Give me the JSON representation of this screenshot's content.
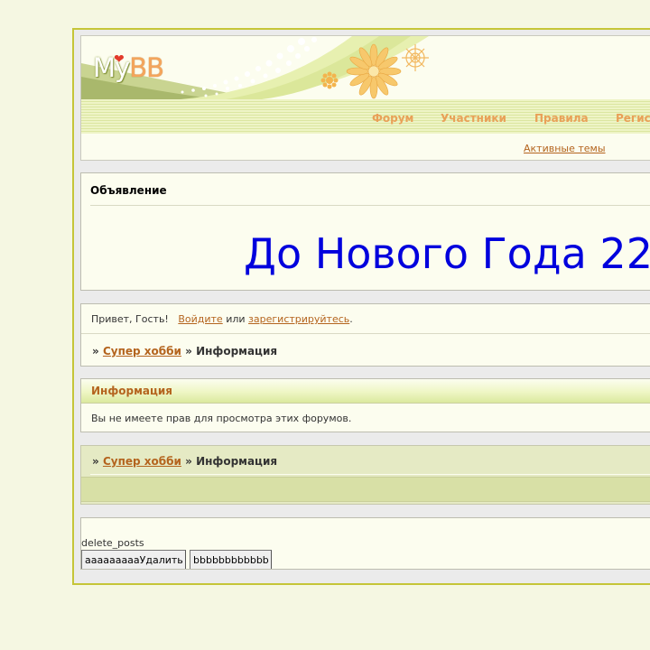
{
  "header": {
    "logo_my": "My",
    "logo_bb": "BB",
    "nav": [
      {
        "label": "Форум"
      },
      {
        "label": "Участники"
      },
      {
        "label": "Правила"
      },
      {
        "label": "Регис"
      }
    ],
    "active_topics": "Активные темы"
  },
  "announcement": {
    "title": "Объявление",
    "text": "До Нового Года 22"
  },
  "welcome": {
    "greeting": "Привет, Гость!",
    "login": "Войдите",
    "or": "или",
    "register": "зарегистрируйтесь",
    "period": "."
  },
  "breadcrumb": {
    "sep": "»",
    "forum": "Супер хобби",
    "current": "Информация"
  },
  "info": {
    "title": "Информация",
    "message": "Вы не имеете прав для просмотра этих форумов."
  },
  "delete_panel": {
    "label": "delete_posts",
    "button1": "aaaaaaaaaУдалить",
    "button2": "bbbbbbbbbbbb"
  },
  "colors": {
    "accent": "#b4641e",
    "nav": "#e9a057",
    "announcement": "#0000dd",
    "frame": "#c5c538"
  }
}
